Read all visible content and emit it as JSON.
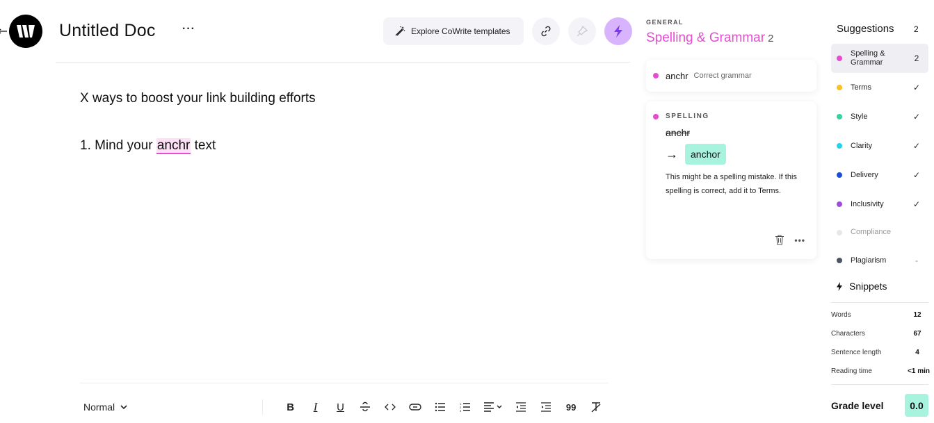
{
  "header": {
    "doc_title": "Untitled Doc",
    "more_label": "···",
    "templates_button": "Explore CoWrite templates",
    "logo_letter": "W"
  },
  "editor": {
    "line1": "X ways to boost your link building efforts",
    "line2_before": "1. Mind your ",
    "line2_flagged": "anchr",
    "line2_after": " text"
  },
  "toolbar": {
    "text_style": "Normal",
    "buttons": [
      "bold",
      "italic",
      "underline",
      "strikethrough",
      "code",
      "link",
      "bullet-list",
      "numbered-list",
      "align",
      "outdent",
      "indent",
      "quote",
      "clear-format"
    ]
  },
  "panel": {
    "kicker": "GENERAL",
    "title": "Spelling & Grammar",
    "count": "2",
    "summary_card": {
      "word": "anchr",
      "hint": "Correct grammar"
    },
    "detail_card": {
      "type_label": "SPELLING",
      "original": "anchr",
      "arrow": "→",
      "replacement": "anchor",
      "explanation": "This might be a spelling mistake. If this spelling is correct, add it to Terms."
    }
  },
  "sidebar": {
    "title": "Suggestions",
    "count": "2",
    "items": [
      {
        "label": "Spelling & Grammar",
        "value": "2",
        "color": "#e64bd0"
      },
      {
        "label": "Terms",
        "value": "✓",
        "color": "#fbbf24"
      },
      {
        "label": "Style",
        "value": "✓",
        "color": "#34d399"
      },
      {
        "label": "Clarity",
        "value": "✓",
        "color": "#22d3ee"
      },
      {
        "label": "Delivery",
        "value": "✓",
        "color": "#1d4ed8"
      },
      {
        "label": "Inclusivity",
        "value": "✓",
        "color": "#9d4edd"
      },
      {
        "label": "Compliance",
        "value": "",
        "color": "#e5e7eb"
      },
      {
        "label": "Plagiarism",
        "value": "-",
        "color": "#4b5563"
      }
    ],
    "snippets_label": "Snippets",
    "stats": [
      {
        "label": "Words",
        "value": "12"
      },
      {
        "label": "Characters",
        "value": "67"
      },
      {
        "label": "Sentence length",
        "value": "4"
      },
      {
        "label": "Reading time",
        "value": "<1 min"
      }
    ],
    "grade_label": "Grade level",
    "grade_value": "0.0"
  },
  "colors": {
    "accent_pink": "#e64bd0",
    "suggestion_green": "#a7f3dd",
    "bolt_purple": "#d8b4fe"
  }
}
